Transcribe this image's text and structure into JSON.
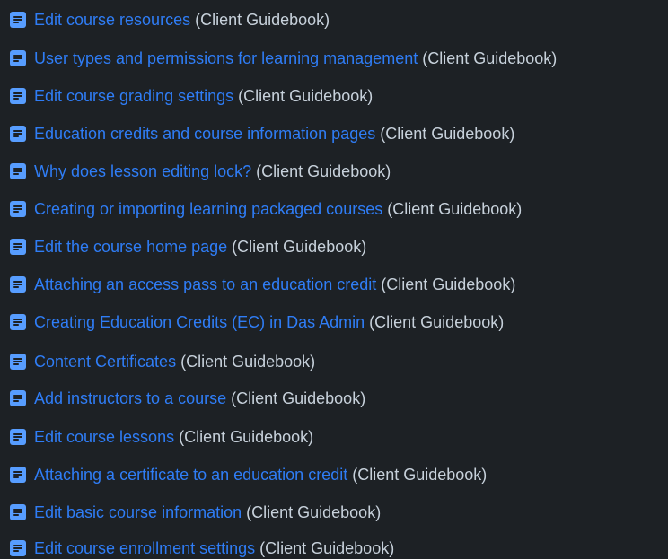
{
  "items": [
    {
      "title": "Edit course resources",
      "source": "(Client Guidebook)",
      "icon": "document-icon"
    },
    {
      "title": "User types and permissions for learning management",
      "source": "(Client Guidebook)",
      "icon": "document-icon"
    },
    {
      "title": "Edit course grading settings",
      "source": "(Client Guidebook)",
      "icon": "document-icon"
    },
    {
      "title": "Education credits and course information pages",
      "source": "(Client Guidebook)",
      "icon": "document-icon"
    },
    {
      "title": "Why does lesson editing lock?",
      "source": "(Client Guidebook)",
      "icon": "document-icon"
    },
    {
      "title": "Creating or importing learning packaged courses",
      "source": "(Client Guidebook)",
      "icon": "document-icon"
    },
    {
      "title": "Edit the course home page",
      "source": "(Client Guidebook)",
      "icon": "document-icon"
    },
    {
      "title": "Attaching an access pass to an education credit",
      "source": "(Client Guidebook)",
      "icon": "document-icon"
    },
    {
      "title": "Creating Education Credits (EC) in Das Admin",
      "source": "(Client Guidebook)",
      "icon": "document-icon"
    },
    {
      "title": "Content Certificates",
      "source": "(Client Guidebook)",
      "icon": "document-icon"
    },
    {
      "title": "Add instructors to a course",
      "source": "(Client Guidebook)",
      "icon": "document-icon"
    },
    {
      "title": "Edit course lessons",
      "source": "(Client Guidebook)",
      "icon": "document-icon"
    },
    {
      "title": "Attaching a certificate to an education credit",
      "source": "(Client Guidebook)",
      "icon": "document-icon"
    },
    {
      "title": "Edit basic course information",
      "source": "(Client Guidebook)",
      "icon": "document-icon"
    },
    {
      "title": "Edit course enrollment settings",
      "source": "(Client Guidebook)",
      "icon": "document-icon"
    }
  ],
  "colors": {
    "background": "#1d2125",
    "link": "#2f7df6",
    "source_text": "#c7d1db",
    "icon": "#579dff"
  }
}
